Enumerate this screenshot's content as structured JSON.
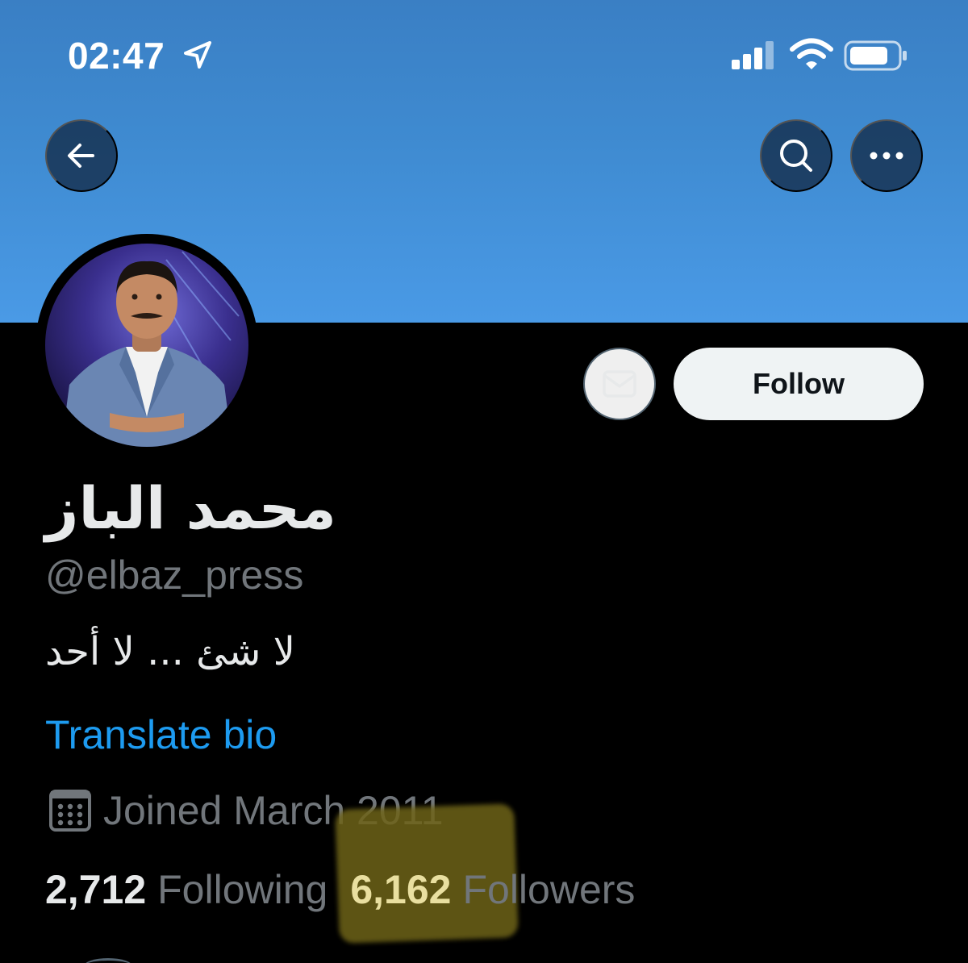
{
  "status_bar": {
    "time": "02:47",
    "icons": [
      "location-arrow-icon",
      "cellular-signal-icon",
      "wifi-icon",
      "battery-icon"
    ]
  },
  "header": {
    "back_icon": "arrow-left-icon",
    "search_icon": "search-icon",
    "more_icon": "more-dots-icon"
  },
  "profile": {
    "display_name": "محمد الباز",
    "handle": "@elbaz_press",
    "bio": "لا شئ ... لا أحد",
    "translate_label": "Translate bio",
    "joined": "Joined March 2011",
    "following_count": "2,712",
    "following_label": "Following",
    "followers_count": "6,162",
    "followers_label": "Followers"
  },
  "actions": {
    "message_icon": "mail-icon",
    "follow_label": "Follow"
  },
  "colors": {
    "banner_blue": "#4a9ae6",
    "link_blue": "#1d9bf0",
    "muted_gray": "#71767b",
    "highlight": "#6e6318"
  }
}
